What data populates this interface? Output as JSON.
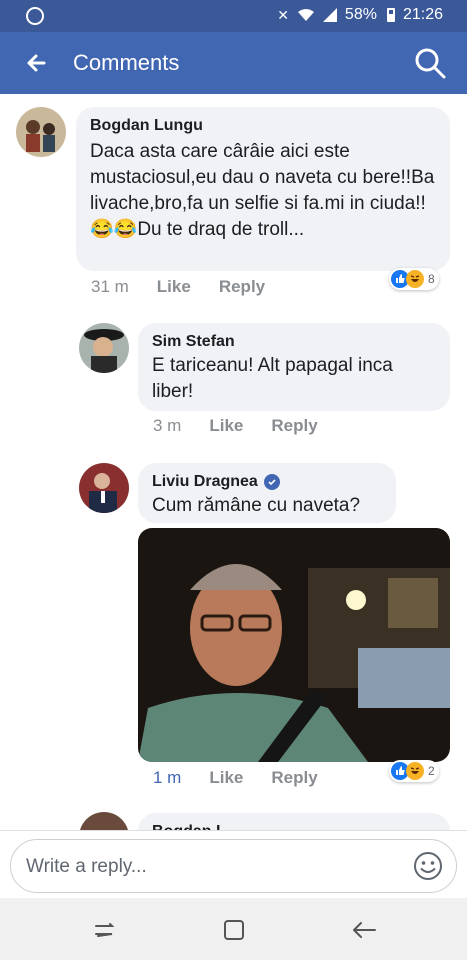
{
  "status_bar": {
    "battery": "58%",
    "time": "21:26"
  },
  "header": {
    "title": "Comments"
  },
  "comments": [
    {
      "author": "Bogdan Lungu",
      "text": "Daca asta care cârâie aici este mustaciosul,eu dau o naveta cu bere!!Ba livache,bro,fa un selfie si fa.mi in ciuda!!😂😂Du te draq de troll...",
      "time": "31 m",
      "like_label": "Like",
      "reply_label": "Reply",
      "reaction_count": "8"
    },
    {
      "author": "Sim Stefan",
      "text": "E tariceanu! Alt papagal inca liber!",
      "time": "3 m",
      "like_label": "Like",
      "reply_label": "Reply"
    },
    {
      "author": "Liviu Dragnea",
      "text": "Cum rămâne cu naveta?",
      "time": "1 m",
      "like_label": "Like",
      "reply_label": "Reply",
      "reaction_count": "2"
    }
  ],
  "partial_comment": {
    "author": "Bogdan L"
  },
  "reply_box": {
    "placeholder": "Write a reply..."
  },
  "colors": {
    "header": "#4267b2",
    "status_bar": "#3b5998",
    "bubble": "#f0f2f5",
    "like": "#1877f2",
    "haha": "#f7b125"
  },
  "icons": [
    "whatsapp-icon",
    "mute-icon",
    "wifi-icon",
    "signal-icon",
    "battery-icon",
    "back-arrow-icon",
    "search-icon",
    "verified-icon",
    "like-reaction-icon",
    "haha-reaction-icon",
    "emoji-icon",
    "recent-apps-icon",
    "home-icon",
    "nav-back-icon"
  ]
}
